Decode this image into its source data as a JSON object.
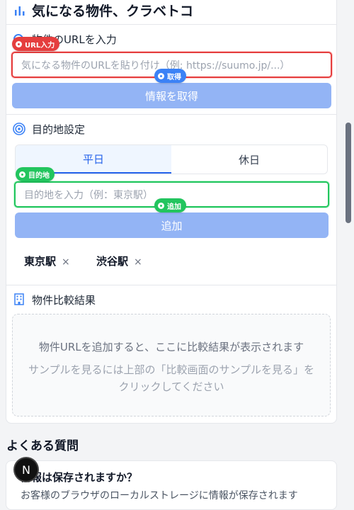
{
  "header": {
    "title": "気になる物件、クラベトコ",
    "icon": "bar-chart-icon"
  },
  "url_section": {
    "label": "物件のURLを入力",
    "badge": "URL入力",
    "placeholder": "気になる物件のURLを貼り付け（例: https://suumo.jp/...）",
    "fetch_badge": "取得",
    "fetch_button": "情報を取得"
  },
  "destination_section": {
    "label": "目的地設定",
    "tabs": [
      {
        "label": "平日",
        "active": true
      },
      {
        "label": "休日",
        "active": false
      }
    ],
    "badge": "目的地",
    "placeholder": "目的地を入力（例：東京駅）",
    "add_badge": "追加",
    "add_button": "追加",
    "chips": [
      {
        "label": "東京駅",
        "remove": "×"
      },
      {
        "label": "渋谷駅",
        "remove": "×"
      }
    ]
  },
  "results_section": {
    "label": "物件比較結果",
    "empty_message": "物件URLを追加すると、ここに比較結果が表示されます",
    "empty_hint": "サンプルを見るには上部の「比較画面のサンプルを見る」をクリックしてください"
  },
  "faq": {
    "title": "よくある質問",
    "question": "情報は保存されますか？",
    "answer": "お客様のブラウザのローカルストレージに情報が保存されます"
  },
  "avatar_letter": "N",
  "colors": {
    "primary": "#3b82f6",
    "button_disabled": "#93b4f5",
    "error": "#e53e3e",
    "success": "#22c55e"
  }
}
